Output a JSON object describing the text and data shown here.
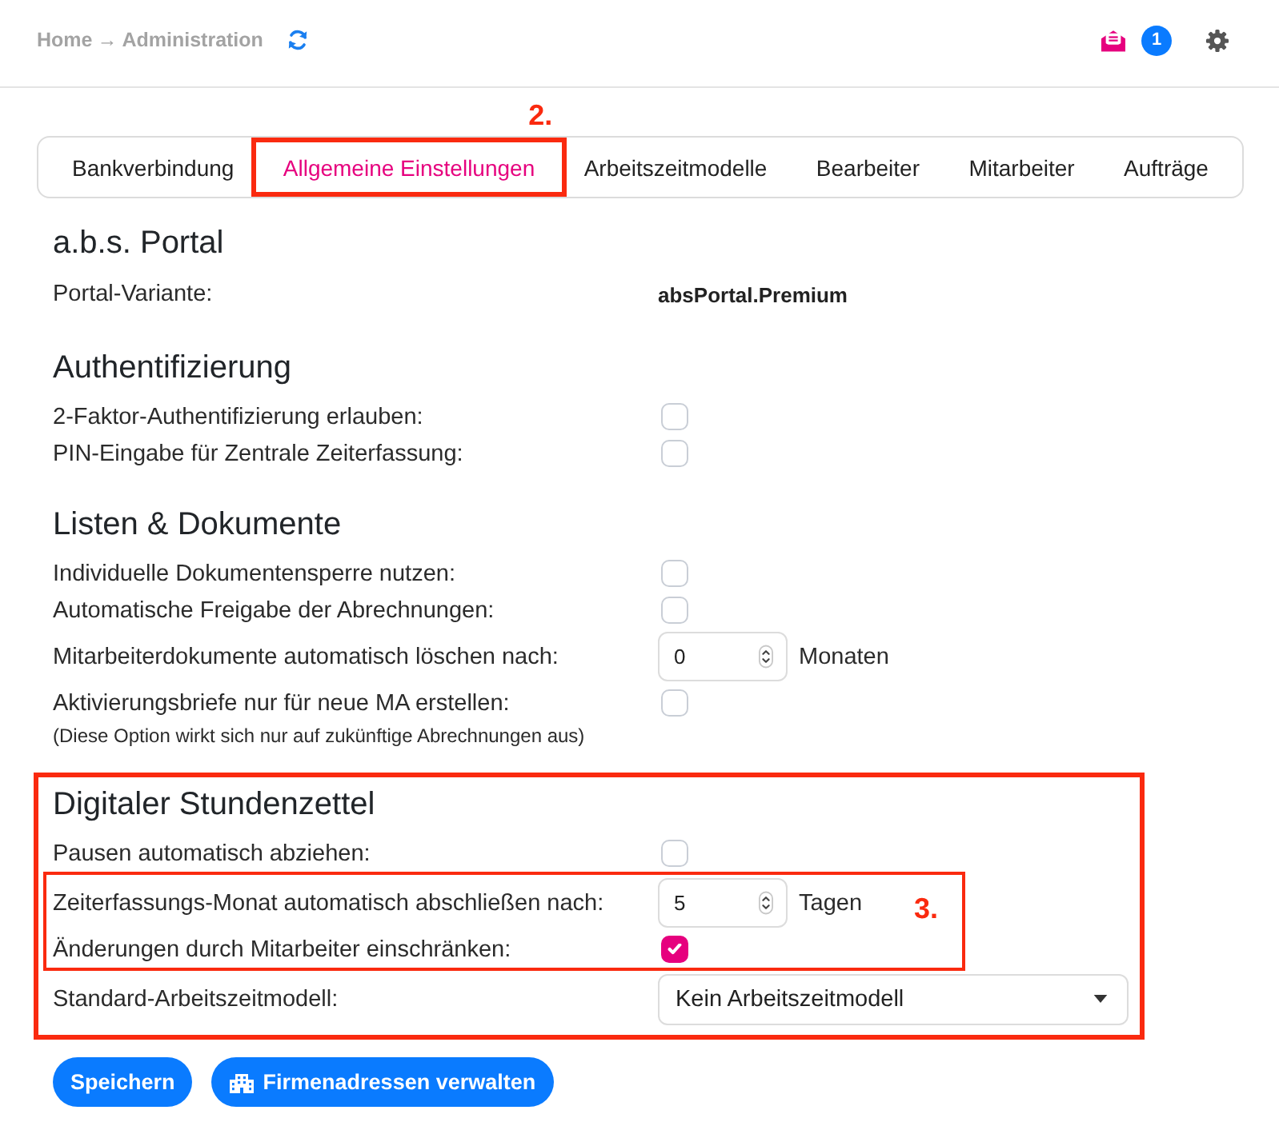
{
  "header": {
    "breadcrumb": {
      "items": [
        "Home",
        "Administration"
      ],
      "separator": "→"
    },
    "notification_count": "1"
  },
  "tabs": [
    {
      "label": "Bankverbindung",
      "selected": false
    },
    {
      "label": "Allgemeine Einstellungen",
      "selected": true,
      "callout": "2."
    },
    {
      "label": "Arbeitszeitmodelle",
      "selected": false
    },
    {
      "label": "Bearbeiter",
      "selected": false
    },
    {
      "label": "Mitarbeiter",
      "selected": false
    },
    {
      "label": "Aufträge",
      "selected": false
    }
  ],
  "sections": [
    {
      "title": "a.b.s. Portal",
      "outlined": false,
      "rows": [
        {
          "kind": "value",
          "label": "Portal-Variante:",
          "value": "absPortal.Premium"
        }
      ]
    },
    {
      "title": "Authentifizierung",
      "outlined": false,
      "rows": [
        {
          "kind": "checkbox",
          "label": "2-Faktor-Authentifizierung erlauben:",
          "checked": false
        },
        {
          "kind": "checkbox",
          "label": "PIN-Eingabe für Zentrale Zeiterfassung:",
          "checked": false
        }
      ]
    },
    {
      "title": "Listen & Dokumente",
      "outlined": false,
      "rows": [
        {
          "kind": "checkbox",
          "label": "Individuelle Dokumentensperre nutzen:",
          "checked": false
        },
        {
          "kind": "checkbox",
          "label": "Automatische Freigabe der Abrechnungen:",
          "checked": false
        },
        {
          "kind": "number",
          "label": "Mitarbeiterdokumente automatisch löschen nach:",
          "value": "0",
          "unit": "Monaten"
        },
        {
          "kind": "checkbox",
          "label": "Aktivierungsbriefe nur für neue MA erstellen:",
          "checked": false
        },
        {
          "kind": "note",
          "text": "(Diese Option wirkt sich nur auf zukünftige Abrechnungen aus)"
        }
      ]
    },
    {
      "title": "Digitaler Stundenzettel",
      "outlined": true,
      "rows": [
        {
          "kind": "checkbox",
          "label": "Pausen automatisch abziehen:",
          "checked": false
        },
        {
          "kind": "callout",
          "label": "3.",
          "rows": [
            {
              "kind": "number",
              "label": "Zeiterfassungs-Monat automatisch abschließen nach:",
              "value": "5",
              "unit": "Tagen"
            },
            {
              "kind": "checkbox",
              "label": "Änderungen durch Mitarbeiter einschränken:",
              "checked": true
            }
          ]
        },
        {
          "kind": "select",
          "label": "Standard-Arbeitszeitmodell:",
          "value": "Kein Arbeitszeitmodell"
        }
      ]
    }
  ],
  "buttons": [
    {
      "label": "Speichern",
      "kind": "text"
    },
    {
      "label": "Firmenadressen verwalten",
      "kind": "with-icon"
    }
  ]
}
